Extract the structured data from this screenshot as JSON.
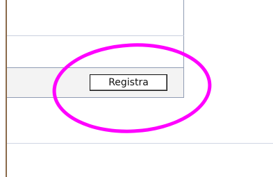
{
  "form": {
    "register_label": "Registra"
  },
  "colors": {
    "annotation_ellipse": "#ff00ff",
    "panel_border": "#8f9bb3",
    "footer_background": "#f3f3f3"
  }
}
